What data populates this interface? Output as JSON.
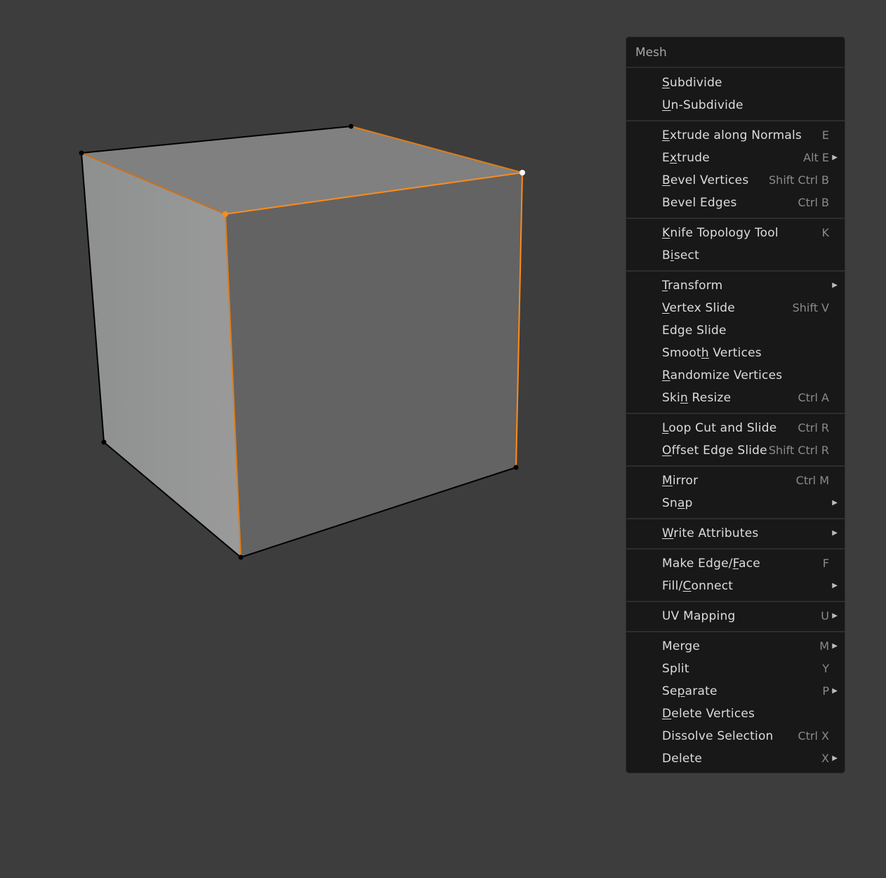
{
  "menu": {
    "title": "Mesh",
    "groups": [
      [
        {
          "label": "Subdivide",
          "u": 0,
          "shortcut": "",
          "submenu": false
        },
        {
          "label": "Un-Subdivide",
          "u": 0,
          "shortcut": "",
          "submenu": false
        }
      ],
      [
        {
          "label": "Extrude along Normals",
          "u": 0,
          "shortcut": "E",
          "submenu": false
        },
        {
          "label": "Extrude",
          "u": 1,
          "shortcut": "Alt E",
          "submenu": true
        },
        {
          "label": "Bevel Vertices",
          "u": 0,
          "shortcut": "Shift Ctrl B",
          "submenu": false
        },
        {
          "label": "Bevel Edges",
          "u": -1,
          "shortcut": "Ctrl B",
          "submenu": false
        }
      ],
      [
        {
          "label": "Knife Topology Tool",
          "u": 0,
          "shortcut": "K",
          "submenu": false
        },
        {
          "label": "Bisect",
          "u": 1,
          "shortcut": "",
          "submenu": false
        }
      ],
      [
        {
          "label": "Transform",
          "u": 0,
          "shortcut": "",
          "submenu": true
        },
        {
          "label": "Vertex Slide",
          "u": 0,
          "shortcut": "Shift V",
          "submenu": false
        },
        {
          "label": "Edge Slide",
          "u": -1,
          "shortcut": "",
          "submenu": false
        },
        {
          "label": "Smooth Vertices",
          "u": 5,
          "shortcut": "",
          "submenu": false
        },
        {
          "label": "Randomize Vertices",
          "u": 0,
          "shortcut": "",
          "submenu": false
        },
        {
          "label": "Skin Resize",
          "u": 3,
          "shortcut": "Ctrl A",
          "submenu": false
        }
      ],
      [
        {
          "label": "Loop Cut and Slide",
          "u": 0,
          "shortcut": "Ctrl R",
          "submenu": false
        },
        {
          "label": "Offset Edge Slide",
          "u": 0,
          "shortcut": "Shift Ctrl R",
          "submenu": false
        }
      ],
      [
        {
          "label": "Mirror",
          "u": 0,
          "shortcut": "Ctrl M",
          "submenu": false
        },
        {
          "label": "Snap",
          "u": 2,
          "shortcut": "",
          "submenu": true
        }
      ],
      [
        {
          "label": "Write Attributes",
          "u": 0,
          "shortcut": "",
          "submenu": true
        }
      ],
      [
        {
          "label": "Make Edge/Face",
          "u": 10,
          "shortcut": "F",
          "submenu": false
        },
        {
          "label": "Fill/Connect",
          "u": 5,
          "shortcut": "",
          "submenu": true
        }
      ],
      [
        {
          "label": "UV Mapping",
          "u": -1,
          "shortcut": "U",
          "submenu": true
        }
      ],
      [
        {
          "label": "Merge",
          "u": -1,
          "shortcut": "M",
          "submenu": true
        },
        {
          "label": "Split",
          "u": -1,
          "shortcut": "Y",
          "submenu": false
        },
        {
          "label": "Separate",
          "u": 2,
          "shortcut": "P",
          "submenu": true
        },
        {
          "label": "Delete Vertices",
          "u": 0,
          "shortcut": "",
          "submenu": false
        },
        {
          "label": "Dissolve Selection",
          "u": -1,
          "shortcut": "Ctrl X",
          "submenu": false
        },
        {
          "label": "Delete",
          "u": -1,
          "shortcut": "X",
          "submenu": true
        }
      ]
    ]
  },
  "viewport": {
    "object": "cube",
    "selection_color": "#ff8c1a",
    "active_vertex_color": "#ffffff",
    "background_color": "#3d3d3d"
  }
}
